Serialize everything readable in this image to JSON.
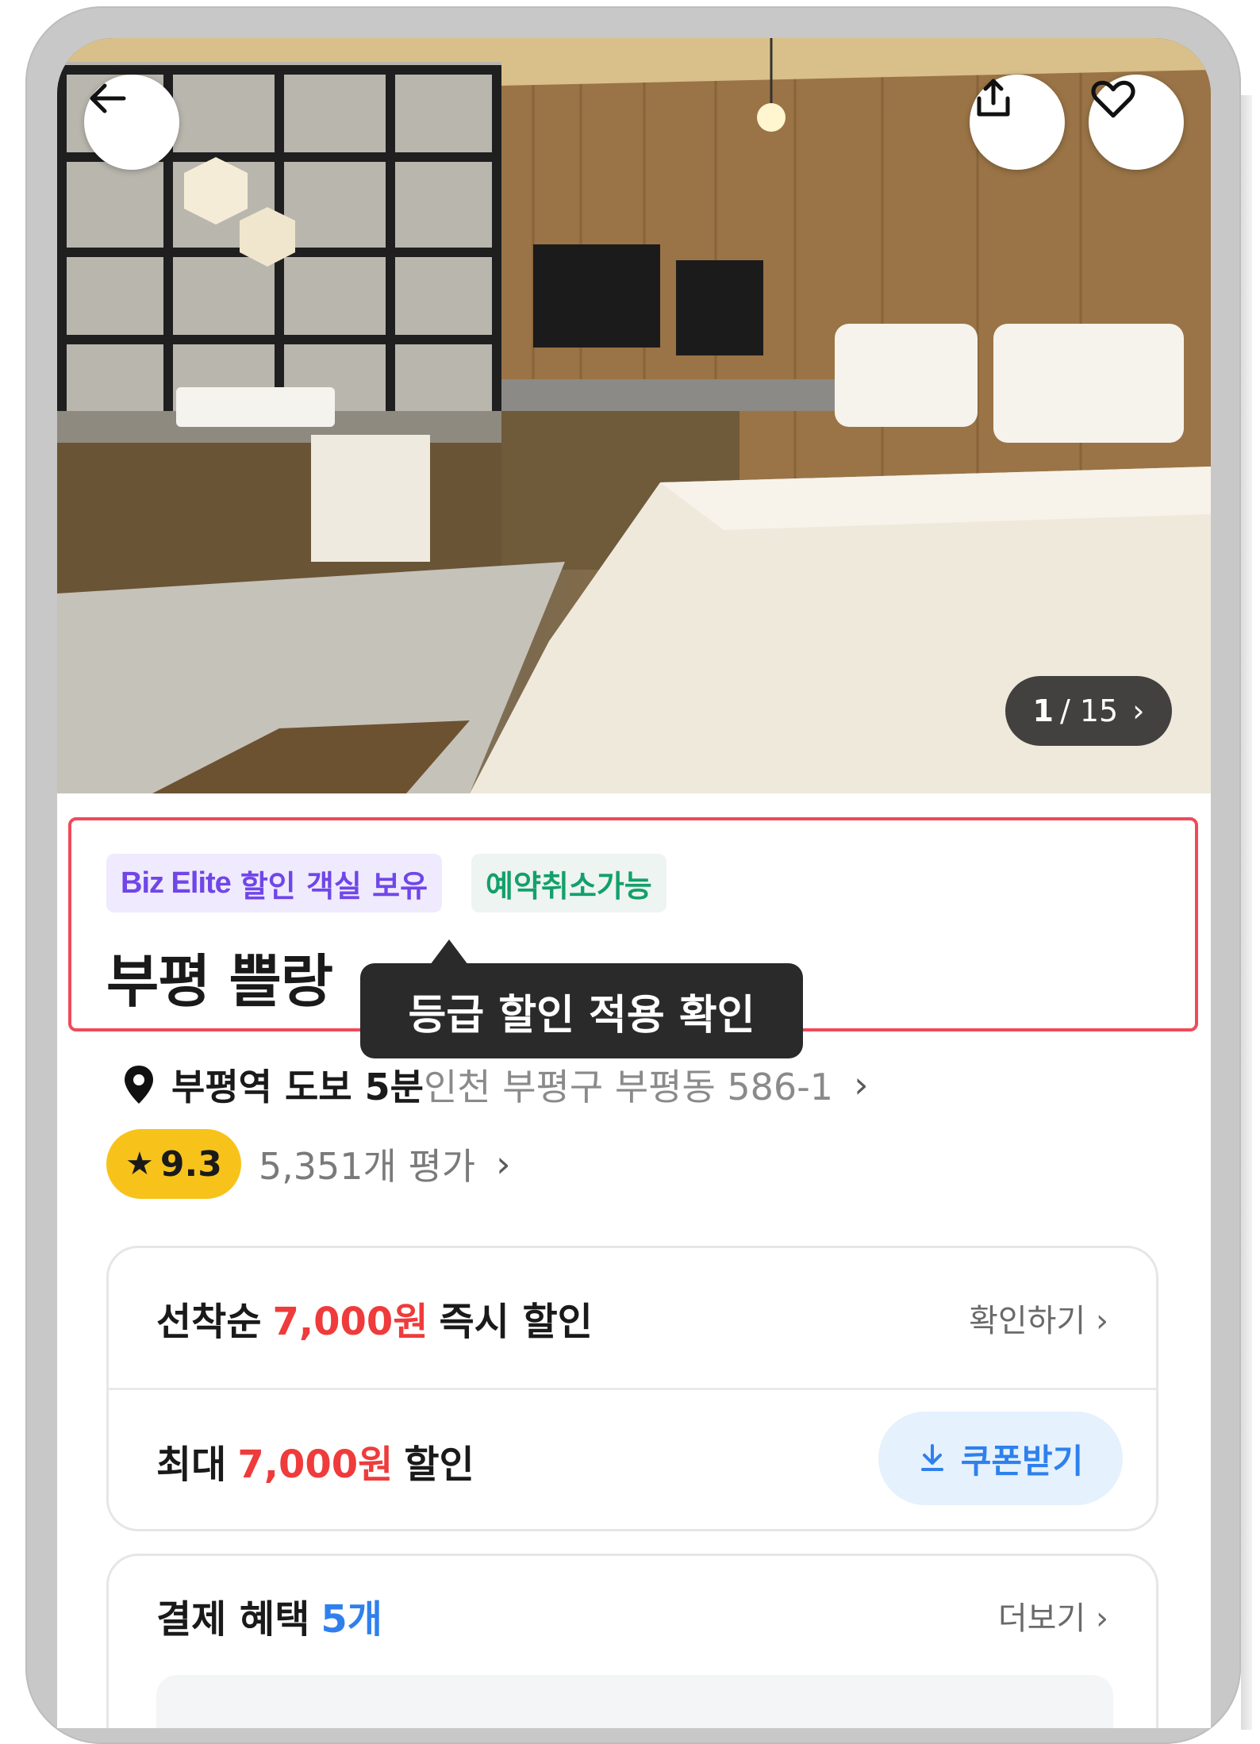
{
  "hero": {
    "pager_current": "1",
    "pager_total": "/ 15",
    "pager_chevron": "›"
  },
  "badges": {
    "biz_brand": "Biz Elite",
    "biz_text": "할인 객실 보유",
    "cancel": "예약취소가능"
  },
  "hotel": {
    "name": "부평 쁠랑",
    "tooltip": "등급 할인 적용 확인",
    "location_strong": "부평역 도보 5분",
    "address": "인천 부평구 부평동 586-1",
    "rating": "9.3",
    "review_count": "5,351개 평가"
  },
  "discount": {
    "row1_prefix": "선착순",
    "row1_amount": "7,000원",
    "row1_suffix": "즉시 할인",
    "row1_link": "확인하기 ›",
    "row2_prefix": "최대",
    "row2_amount": "7,000원",
    "row2_suffix": "할인",
    "coupon_button": "쿠폰받기"
  },
  "payment": {
    "title_prefix": "결제 혜택",
    "count": "5개",
    "more_link": "더보기 ›"
  },
  "colors": {
    "accent_red": "#ef3b3b",
    "accent_blue": "#2f80ed",
    "rating_yellow": "#f7c31b",
    "highlight_border": "#ef4a5a"
  },
  "icons": [
    "back-arrow-icon",
    "share-icon",
    "heart-icon",
    "location-pin-icon",
    "star-icon",
    "download-icon",
    "chevron-right-icon"
  ]
}
